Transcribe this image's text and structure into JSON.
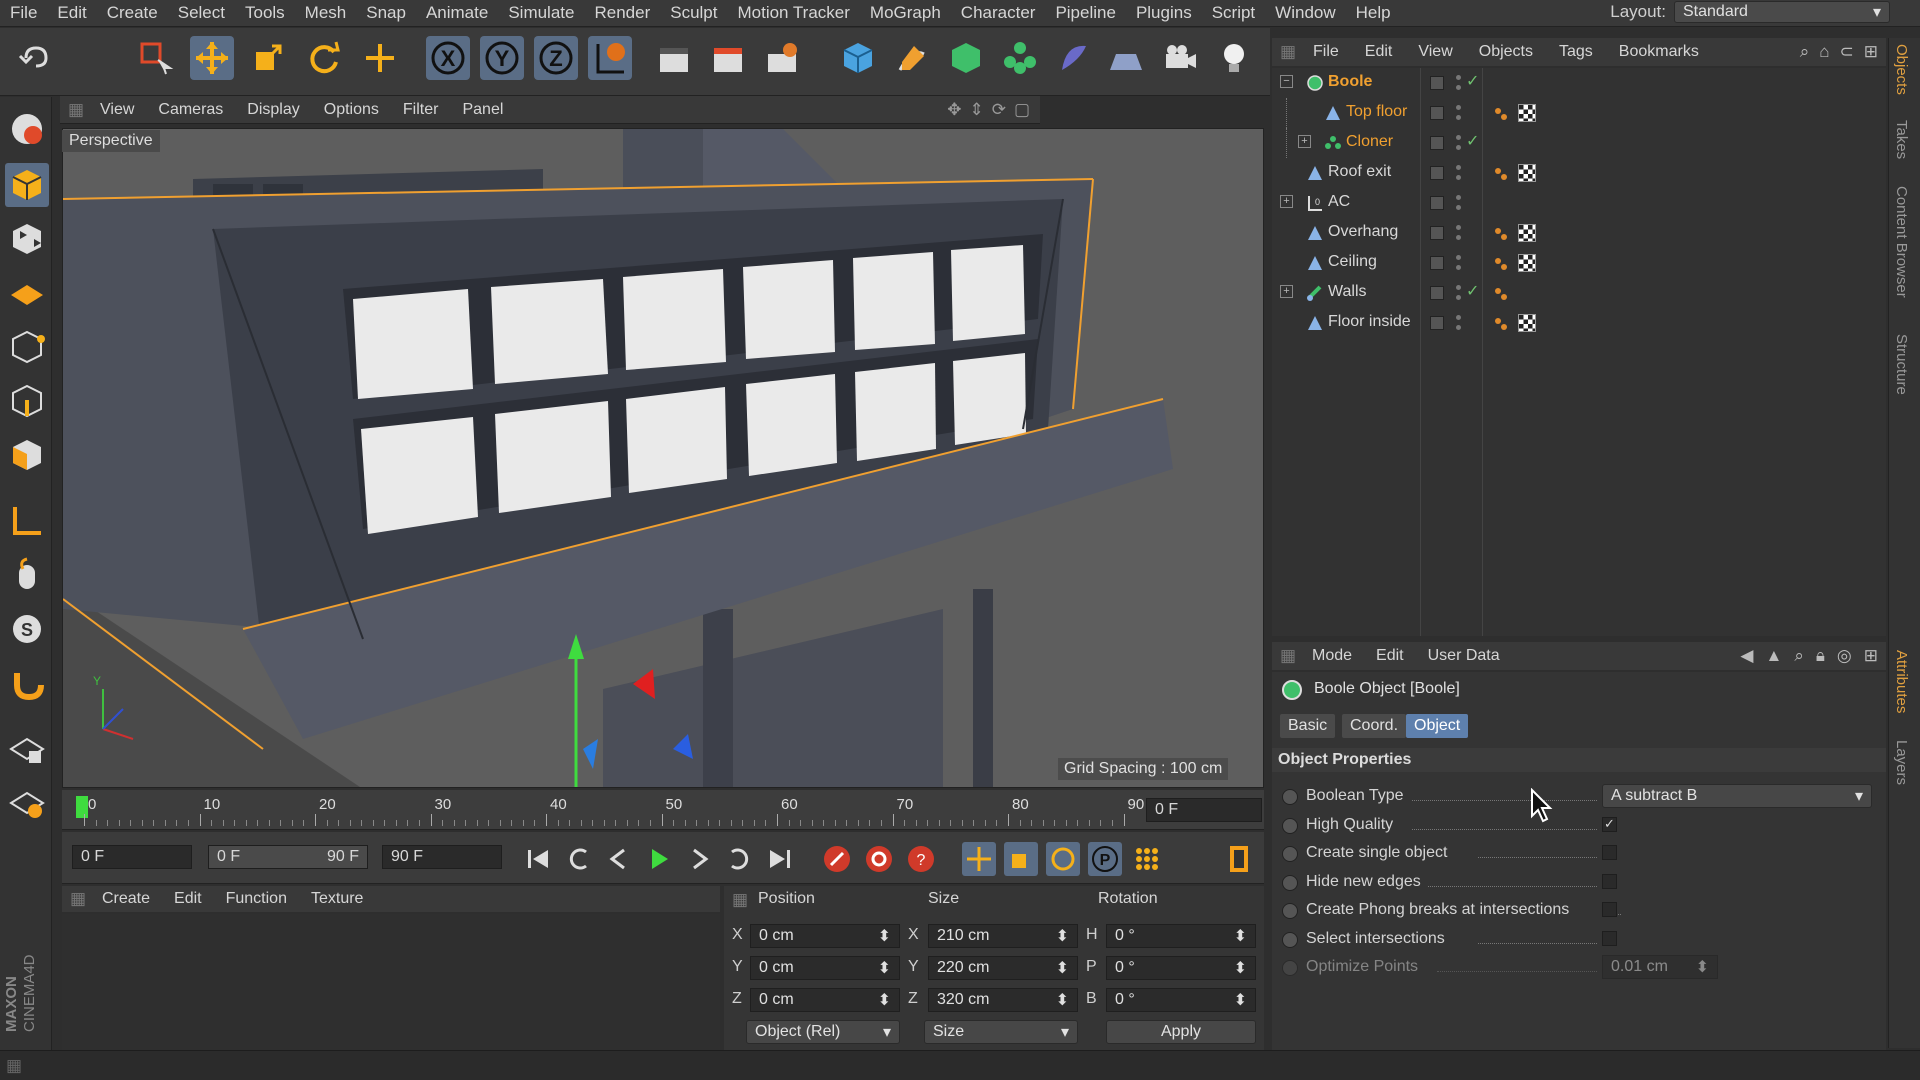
{
  "menubar": {
    "items": [
      "File",
      "Edit",
      "Create",
      "Select",
      "Tools",
      "Mesh",
      "Snap",
      "Animate",
      "Simulate",
      "Render",
      "Sculpt",
      "Motion Tracker",
      "MoGraph",
      "Character",
      "Pipeline",
      "Plugins",
      "Script",
      "Window",
      "Help"
    ],
    "layout_label": "Layout:",
    "layout_value": "Standard"
  },
  "viewport": {
    "menu": [
      "View",
      "Cameras",
      "Display",
      "Options",
      "Filter",
      "Panel"
    ],
    "label": "Perspective",
    "grid_spacing": "Grid Spacing : 100 cm"
  },
  "timeline": {
    "ticks": [
      "0",
      "10",
      "20",
      "30",
      "40",
      "50",
      "60",
      "70",
      "80",
      "90"
    ],
    "current_frame": "0 F"
  },
  "transport": {
    "start": "0 F",
    "range_start": "0 F",
    "range_end": "90 F",
    "end": "90 F"
  },
  "materials": {
    "menu": [
      "Create",
      "Edit",
      "Function",
      "Texture"
    ]
  },
  "coordinates": {
    "headers": {
      "position": "Position",
      "size": "Size",
      "rotation": "Rotation"
    },
    "rows": [
      {
        "axis": "X",
        "pos": "0 cm",
        "size_axis": "X",
        "size": "210 cm",
        "rot_axis": "H",
        "rot": "0 °"
      },
      {
        "axis": "Y",
        "pos": "0 cm",
        "size_axis": "Y",
        "size": "220 cm",
        "rot_axis": "P",
        "rot": "0 °"
      },
      {
        "axis": "Z",
        "pos": "0 cm",
        "size_axis": "Z",
        "size": "320 cm",
        "rot_axis": "B",
        "rot": "0 °"
      }
    ],
    "mode_select": "Object (Rel)",
    "size_select": "Size",
    "apply": "Apply"
  },
  "objects": {
    "menu": [
      "File",
      "Edit",
      "View",
      "Objects",
      "Tags",
      "Bookmarks"
    ],
    "items": [
      {
        "name": "Boole",
        "style": "sel",
        "indent": 0,
        "icon": "boole-icon"
      },
      {
        "name": "Top floor",
        "style": "hl",
        "indent": 1,
        "icon": "polygon-object-icon"
      },
      {
        "name": "Cloner",
        "style": "hl",
        "indent": 1,
        "icon": "cloner-icon"
      },
      {
        "name": "Roof exit",
        "style": "",
        "indent": 0,
        "icon": "polygon-object-icon"
      },
      {
        "name": "AC",
        "style": "",
        "indent": 0,
        "icon": "null-icon"
      },
      {
        "name": "Overhang",
        "style": "",
        "indent": 0,
        "icon": "polygon-object-icon"
      },
      {
        "name": "Ceiling",
        "style": "",
        "indent": 0,
        "icon": "polygon-object-icon"
      },
      {
        "name": "Walls",
        "style": "",
        "indent": 0,
        "icon": "connect-icon"
      },
      {
        "name": "Floor inside",
        "style": "",
        "indent": 0,
        "icon": "polygon-object-icon"
      }
    ]
  },
  "attributes": {
    "menu": [
      "Mode",
      "Edit",
      "User Data"
    ],
    "title": "Boole Object [Boole]",
    "tabs": [
      "Basic",
      "Coord.",
      "Object"
    ],
    "active_tab": "Object",
    "section": "Object Properties",
    "props": [
      {
        "label": "Boolean Type",
        "type": "select",
        "value": "A subtract B"
      },
      {
        "label": "High Quality",
        "type": "check",
        "value": "✓"
      },
      {
        "label": "Create single object",
        "type": "check",
        "value": ""
      },
      {
        "label": "Hide new edges",
        "type": "check",
        "value": ""
      },
      {
        "label": "Create Phong breaks at intersections",
        "type": "check",
        "value": ""
      },
      {
        "label": "Select intersections",
        "type": "check",
        "value": ""
      },
      {
        "label": "Optimize Points",
        "type": "number",
        "value": "0.01 cm"
      }
    ]
  },
  "right_tabs": [
    "Objects",
    "Takes",
    "Content Browser",
    "Structure",
    "Attributes",
    "Layers"
  ],
  "brand": "MAXON CINEMA 4D",
  "colors": {
    "accent": "#5e80ad",
    "highlight": "#f0a030",
    "check": "#6fc06f"
  }
}
